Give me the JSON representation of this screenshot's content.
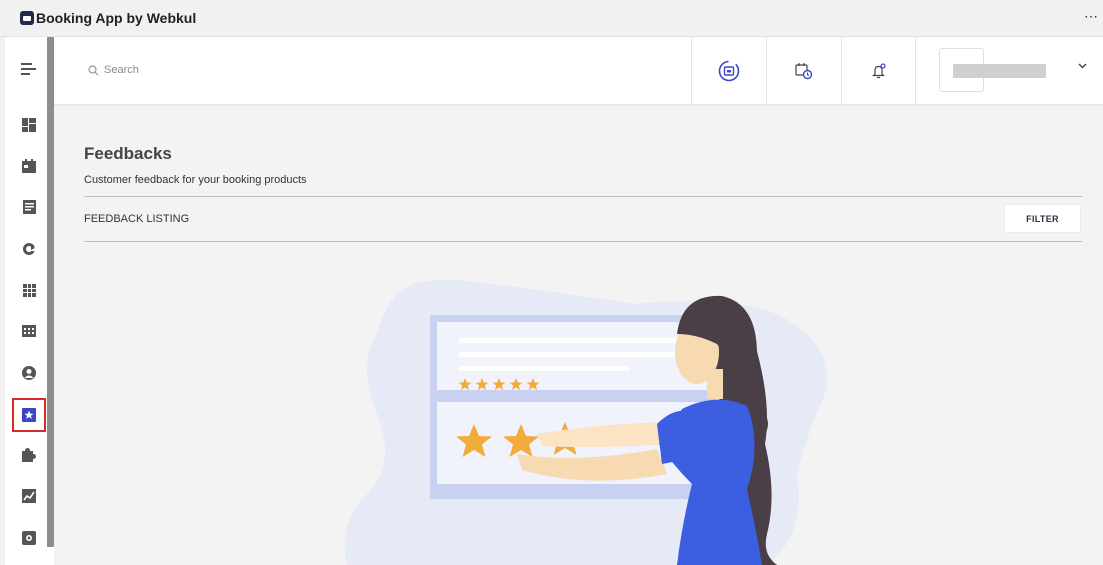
{
  "window": {
    "title": "Booking App by Webkul",
    "more_icon": "ellipsis-icon"
  },
  "sidebar": {
    "items": [
      {
        "id": "menu",
        "icon": "hamburger-menu-icon"
      },
      {
        "id": "dashboard",
        "icon": "dashboard-icon"
      },
      {
        "id": "calendar",
        "icon": "calendar-icon"
      },
      {
        "id": "orders",
        "icon": "document-icon"
      },
      {
        "id": "sync",
        "icon": "sync-icon"
      },
      {
        "id": "grid",
        "icon": "grid-icon"
      },
      {
        "id": "slots",
        "icon": "slots-icon"
      },
      {
        "id": "customers",
        "icon": "user-icon"
      },
      {
        "id": "feedbacks",
        "icon": "star-icon",
        "active": true
      },
      {
        "id": "extensions",
        "icon": "puzzle-icon"
      },
      {
        "id": "reports",
        "icon": "report-icon"
      },
      {
        "id": "settings",
        "icon": "gear-icon"
      }
    ]
  },
  "header": {
    "search_placeholder": "Search",
    "actions": [
      {
        "id": "booking-sync",
        "icon": "calendar-sync-icon"
      },
      {
        "id": "schedule",
        "icon": "calendar-clock-icon"
      },
      {
        "id": "notifications",
        "icon": "bell-icon"
      }
    ],
    "profile_caret_icon": "chevron-down-icon"
  },
  "main": {
    "title": "Feedbacks",
    "subtitle": "Customer feedback for your booking products",
    "listing_label": "FEEDBACK LISTING",
    "filter_label": "FILTER"
  },
  "colors": {
    "accent": "#3b45c8",
    "active_outline": "#d62a2a",
    "star": "#f2ac3b",
    "shirt": "#3b5fe0"
  }
}
